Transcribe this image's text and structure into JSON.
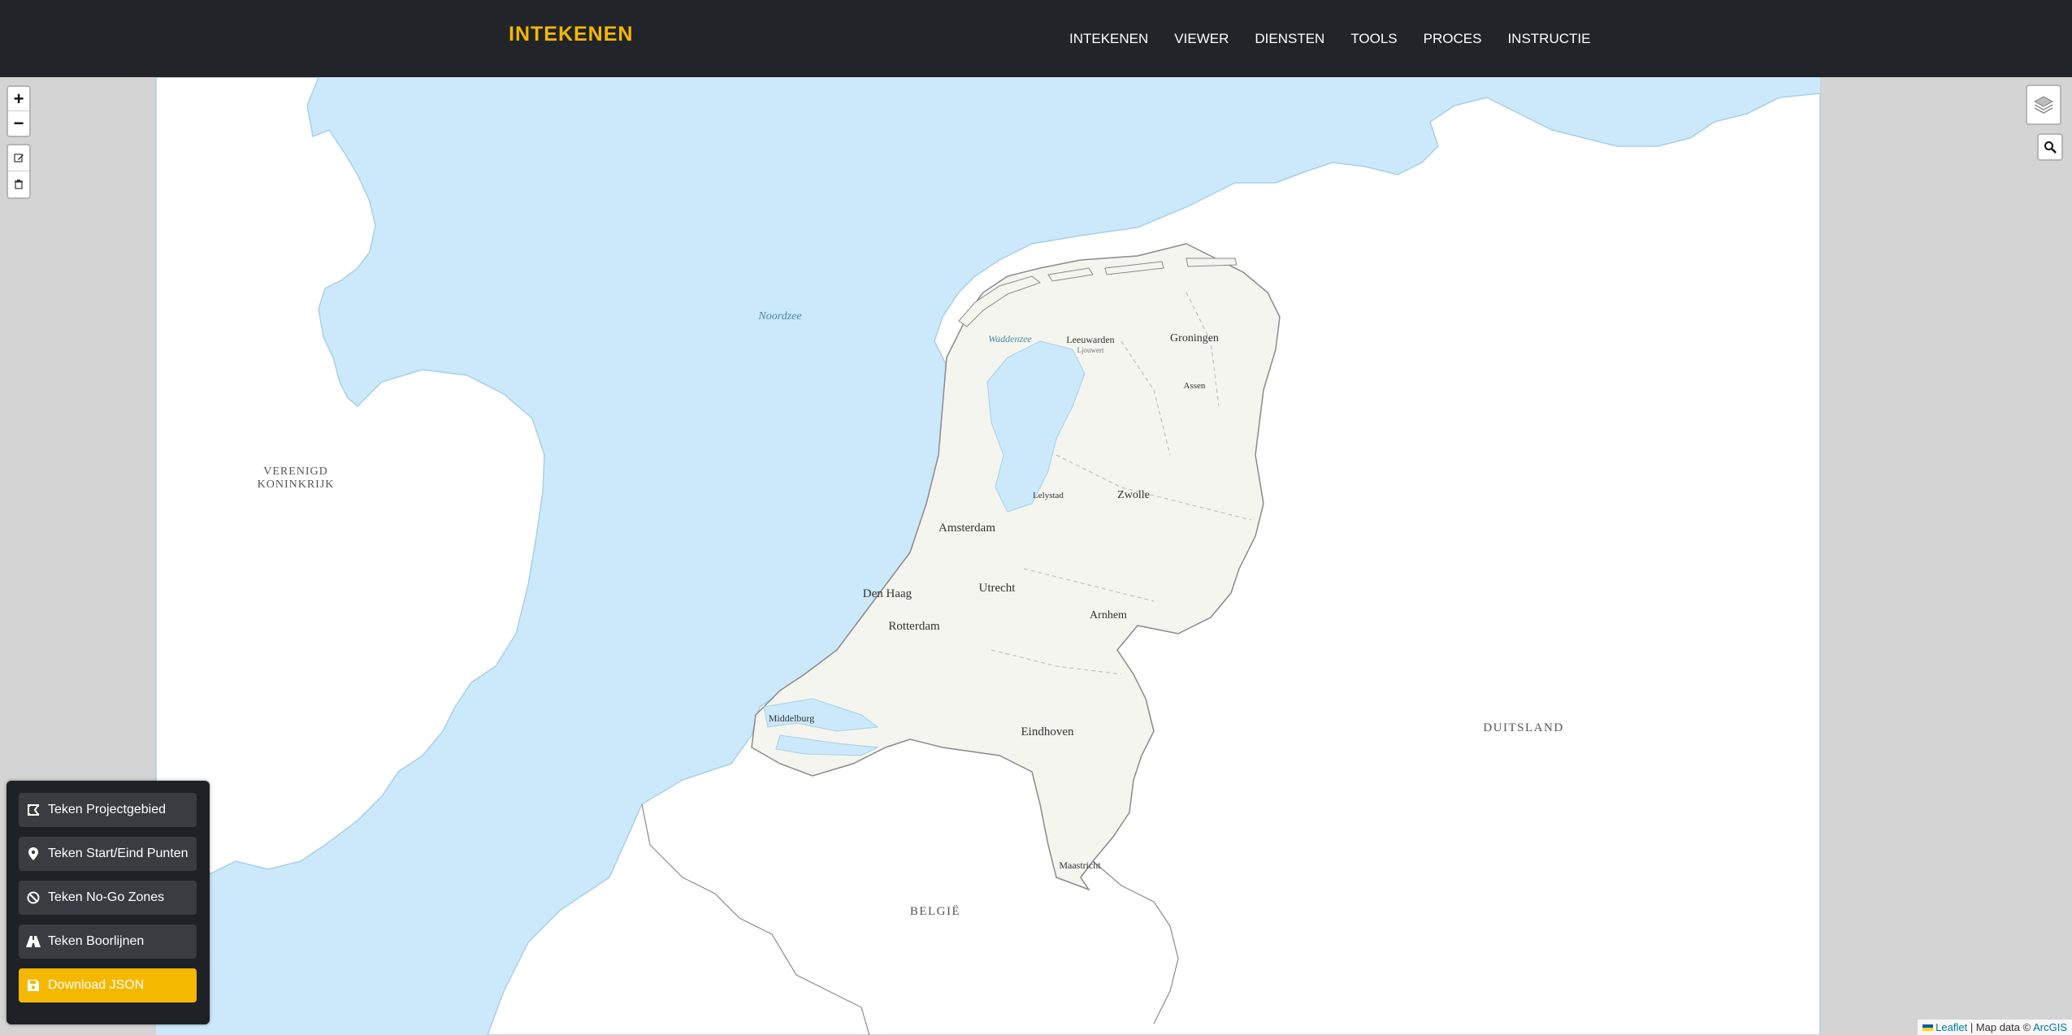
{
  "navbar": {
    "brand": "INTEKENEN",
    "links": [
      "INTEKENEN",
      "VIEWER",
      "DIENSTEN",
      "TOOLS",
      "PROCES",
      "INSTRUCTIE"
    ]
  },
  "map": {
    "zoom_in": "+",
    "zoom_out": "−",
    "labels": {
      "noordzee": "Noordzee",
      "waddenzee": "Waddenzee",
      "verenigd": "VERENIGD",
      "koninkrijk": "KONINKRIJK",
      "duitsland": "DUITSLAND",
      "belgie": "BELGIË",
      "leeuwarden": "Leeuwarden",
      "ljouwert": "Ljouwert",
      "groningen": "Groningen",
      "assen": "Assen",
      "lelystad": "Lelystad",
      "zwolle": "Zwolle",
      "amsterdam": "Amsterdam",
      "utrecht": "Utrecht",
      "denhaag": "Den Haag",
      "rotterdam": "Rotterdam",
      "arnhem": "Arnhem",
      "middelburg": "Middelburg",
      "eindhoven": "Eindhoven",
      "maastricht": "Maastricht"
    },
    "colors": {
      "water": "#cbe9fb",
      "land": "#ffffff",
      "nl_land": "#f3f5ee",
      "outside": "#d4d4d4"
    }
  },
  "attribution": {
    "leaflet": "Leaflet",
    "separator": " | Map data © ",
    "arcgis": "ArcGIS"
  },
  "panel": {
    "buttons": [
      {
        "label": "Teken Projectgebied",
        "icon": "draw-polygon-icon"
      },
      {
        "label": "Teken Start/Eind Punten",
        "icon": "map-marker-icon"
      },
      {
        "label": "Teken No-Go Zones",
        "icon": "ban-icon"
      },
      {
        "label": "Teken Boorlijnen",
        "icon": "road-icon"
      },
      {
        "label": "Download JSON",
        "icon": "save-icon"
      }
    ]
  }
}
